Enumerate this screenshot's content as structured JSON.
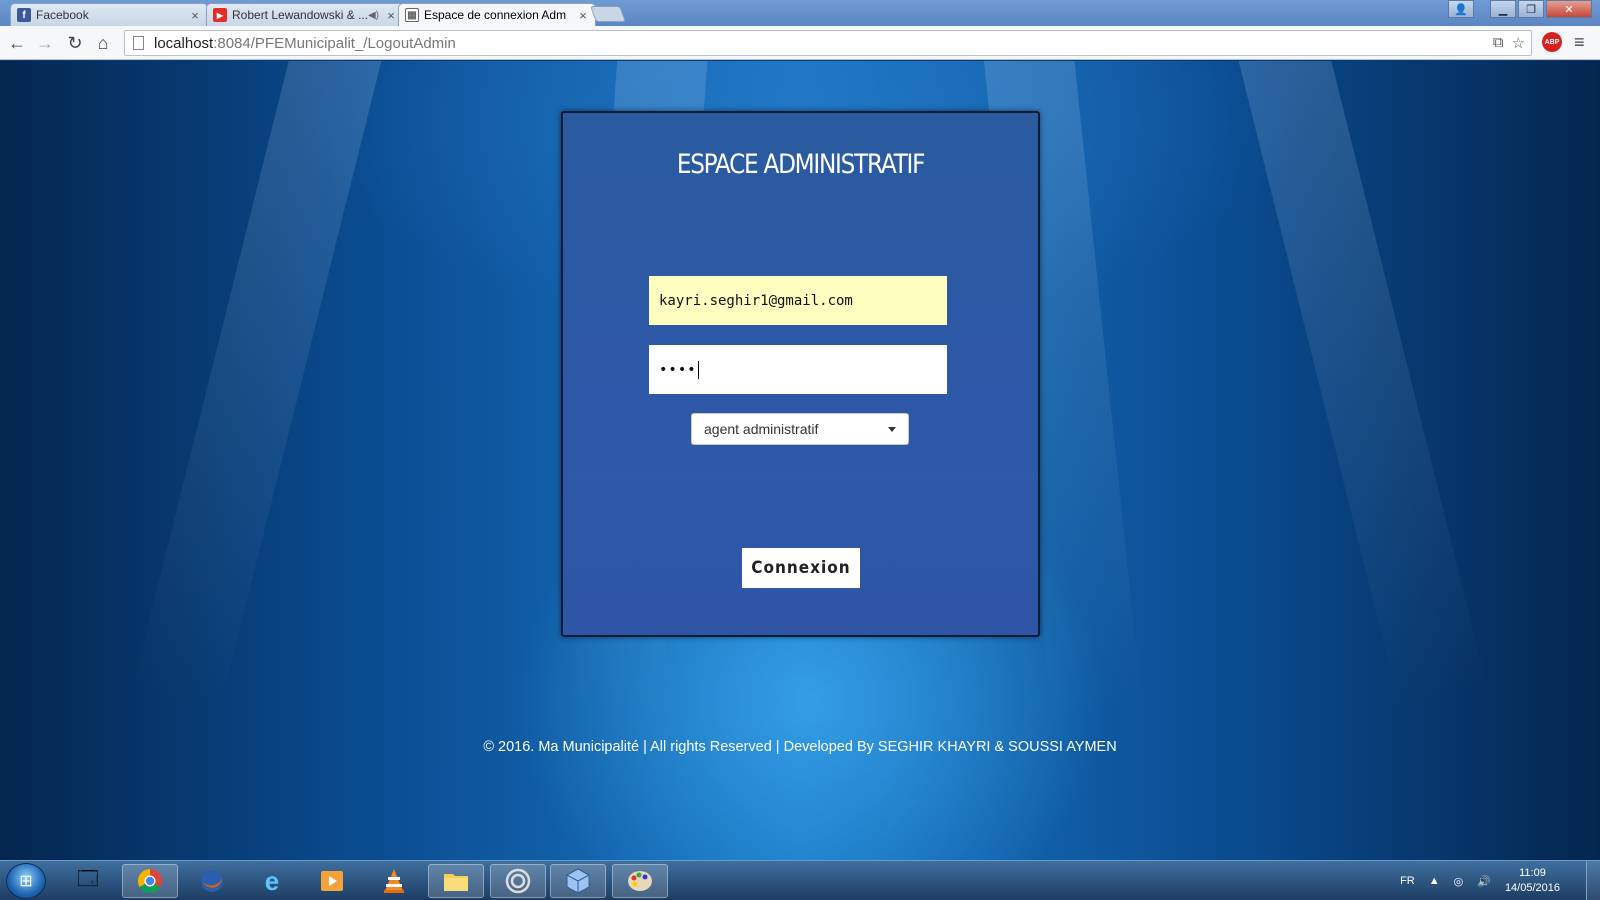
{
  "browser": {
    "tabs": [
      {
        "label": "Facebook",
        "icon": "facebook-icon",
        "icon_color": "#3b5998"
      },
      {
        "label": "Robert Lewandowski & ...",
        "icon": "youtube-icon",
        "icon_color": "#e52d27"
      },
      {
        "label": "Espace de connexion Adm",
        "icon": "page-icon",
        "icon_color": "#666666"
      }
    ],
    "url_host": "localhost",
    "url_path": ":8084/PFEMunicipalit_/LogoutAdmin",
    "abp_label": "ABP"
  },
  "login": {
    "title": "ESPACE ADMINISTRATIF",
    "email_value": "kayri.seghir1@gmail.com",
    "password_value": "••••",
    "role_selected": "agent administratif",
    "submit_label": "Connexion"
  },
  "footer": {
    "text": "© 2016. Ma Municipalité | All rights Reserved | Developed By SEGHIR KHAYRI & SOUSSI AYMEN"
  },
  "taskbar": {
    "language": "FR",
    "time": "11:09",
    "date": "14/05/2016"
  },
  "colors": {
    "card_bg": "#2d58a8",
    "email_bg": "#fefdc0",
    "page_accent": "#1877c4"
  }
}
